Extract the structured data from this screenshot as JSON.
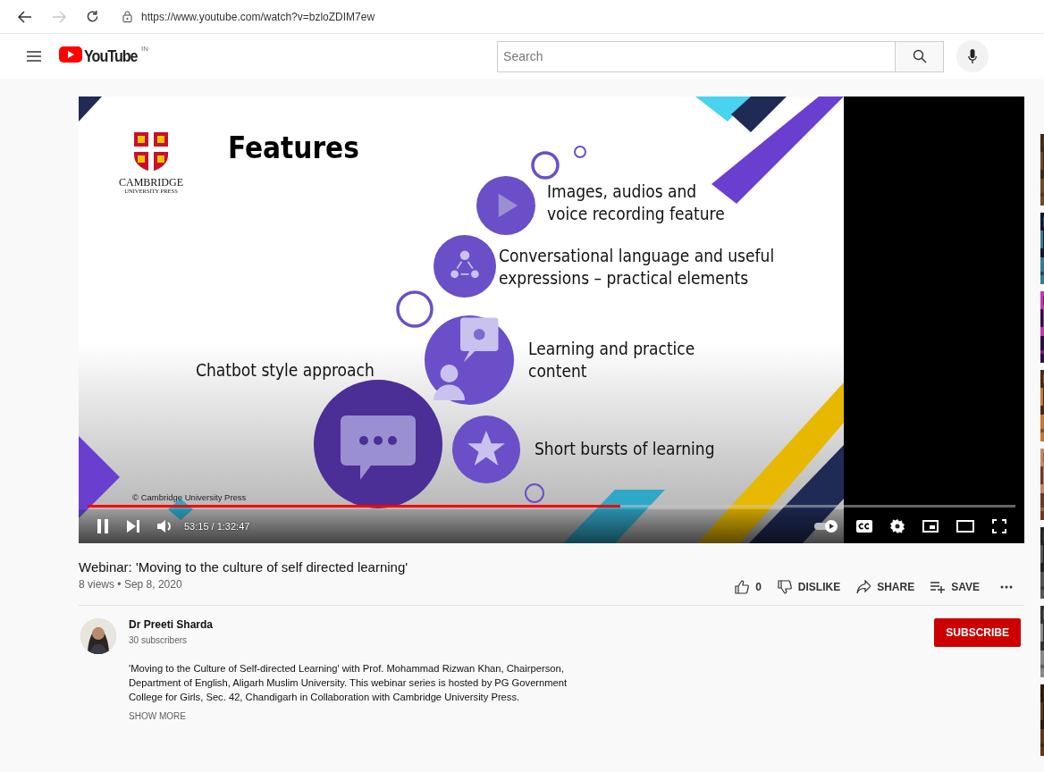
{
  "browser": {
    "url": "https://www.youtube.com/watch?v=bzloZDIM7ew",
    "forward_disabled": true
  },
  "header": {
    "logo_text": "YouTube",
    "country": "IN",
    "search": {
      "placeholder": "Search"
    }
  },
  "player": {
    "playing": true,
    "progress": {
      "level": 0.574
    },
    "time": "53:15 / 1:32:47",
    "autoplay": {
      "on": true
    },
    "slide": {
      "title": "Features",
      "publisher": [
        "CAMBRIDGE",
        "UNIVERSITY PRESS"
      ],
      "side_caption": "Chatbot style approach",
      "copyright": "© Cambridge University Press",
      "items": [
        {
          "kind": "play",
          "lines": [
            "Images, audios and",
            "voice recording feature"
          ]
        },
        {
          "kind": "people",
          "lines": [
            "Conversational language and useful",
            "expressions – practical elements"
          ]
        },
        {
          "kind": "idea",
          "lines": [
            "Learning and practice",
            "content"
          ]
        },
        {
          "kind": "star",
          "lines": [
            "Short bursts of learning"
          ]
        }
      ]
    }
  },
  "video": {
    "title": "Webinar: 'Moving to the culture of self directed learning'",
    "stats": "8 views • Sep 8, 2020",
    "actions": [
      {
        "kind": "like",
        "label": "0"
      },
      {
        "kind": "dislike",
        "label": "DISLIKE"
      },
      {
        "kind": "share",
        "label": "SHARE"
      },
      {
        "kind": "save",
        "label": "SAVE"
      },
      {
        "kind": "more"
      }
    ]
  },
  "channel": {
    "name": "Dr Preeti Sharda",
    "subscribers": "30 subscribers",
    "subscribe": "SUBSCRIBE"
  },
  "description": {
    "text": "'Moving to the Culture of Self-directed Learning' with Prof. Mohammad Rizwan Khan, Chairperson, Department of English, Aligarh Muslim University. This webinar series is hosted by PG Government College for Girls, Sec. 42, Chandigarh in Collaboration with Cambridge University Press.",
    "more": "SHOW MORE"
  }
}
